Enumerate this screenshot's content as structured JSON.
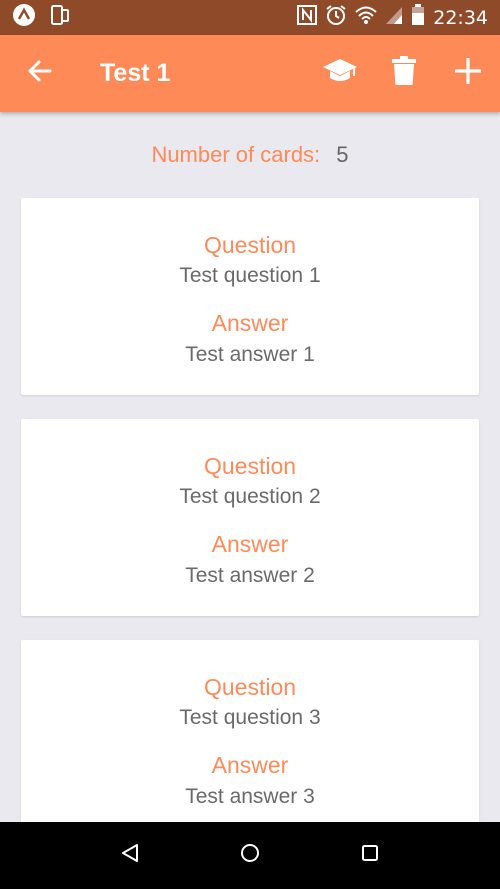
{
  "status_bar": {
    "time": "22:34",
    "icons": [
      "app-a-icon",
      "phone-icon",
      "nfc-icon",
      "alarm-icon",
      "wifi-icon",
      "signal-icon",
      "battery-icon"
    ]
  },
  "app_bar": {
    "title": "Test 1",
    "actions": [
      "study-icon",
      "trash-icon",
      "add-icon"
    ]
  },
  "summary": {
    "label": "Number of cards:",
    "value": "5"
  },
  "cards": [
    {
      "question_label": "Question",
      "question": "Test question 1",
      "answer_label": "Answer",
      "answer": "Test answer 1"
    },
    {
      "question_label": "Question",
      "question": "Test question 2",
      "answer_label": "Answer",
      "answer": "Test answer 2"
    },
    {
      "question_label": "Question",
      "question": "Test question 3",
      "answer_label": "Answer",
      "answer": "Test answer 3"
    }
  ],
  "colors": {
    "accent": "#fe8a57",
    "status_bar": "#8f4a2a",
    "background": "#e9e9ef"
  }
}
